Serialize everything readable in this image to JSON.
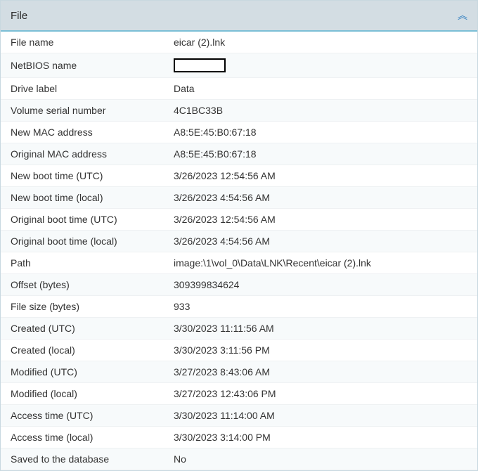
{
  "panel": {
    "title": "File",
    "collapse_icon": "︽",
    "fields": [
      {
        "label": "File name",
        "value": "eicar (2).lnk"
      },
      {
        "label": "NetBIOS name",
        "value": "",
        "redacted": true
      },
      {
        "label": "Drive label",
        "value": "Data"
      },
      {
        "label": "Volume serial number",
        "value": "4C1BC33B"
      },
      {
        "label": "New MAC address",
        "value": "A8:5E:45:B0:67:18"
      },
      {
        "label": "Original MAC address",
        "value": "A8:5E:45:B0:67:18"
      },
      {
        "label": "New boot time (UTC)",
        "value": "3/26/2023 12:54:56 AM"
      },
      {
        "label": "New boot time (local)",
        "value": "3/26/2023 4:54:56 AM"
      },
      {
        "label": "Original boot time (UTC)",
        "value": "3/26/2023 12:54:56 AM"
      },
      {
        "label": "Original boot time (local)",
        "value": "3/26/2023 4:54:56 AM"
      },
      {
        "label": "Path",
        "value": "image:\\1\\vol_0\\Data\\LNK\\Recent\\eicar (2).lnk"
      },
      {
        "label": "Offset (bytes)",
        "value": "309399834624"
      },
      {
        "label": "File size (bytes)",
        "value": "933"
      },
      {
        "label": "Created (UTC)",
        "value": "3/30/2023 11:11:56 AM"
      },
      {
        "label": "Created (local)",
        "value": "3/30/2023 3:11:56 PM"
      },
      {
        "label": "Modified (UTC)",
        "value": "3/27/2023 8:43:06 AM"
      },
      {
        "label": "Modified (local)",
        "value": "3/27/2023 12:43:06 PM"
      },
      {
        "label": "Access time (UTC)",
        "value": "3/30/2023 11:14:00 AM"
      },
      {
        "label": "Access time (local)",
        "value": "3/30/2023 3:14:00 PM"
      },
      {
        "label": "Saved to the database",
        "value": "No"
      }
    ]
  }
}
